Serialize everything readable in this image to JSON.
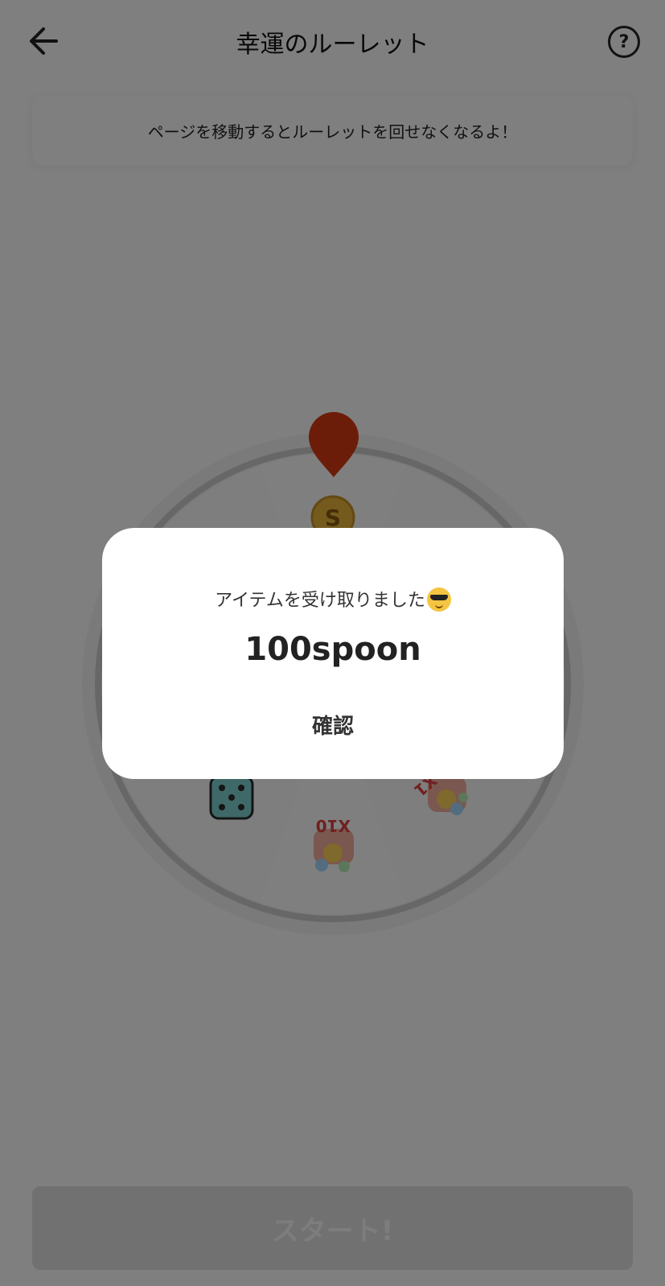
{
  "header": {
    "title": "幸運のルーレット",
    "help_label": "?"
  },
  "notice": {
    "text": "ページを移動するとルーレットを回せなくなるよ！"
  },
  "wheel": {
    "pointer_color": "#d93a12",
    "coin_label": "S",
    "segment_labels": [
      "X10",
      "X1"
    ]
  },
  "start_button": {
    "label": "スタート!"
  },
  "modal": {
    "message": "アイテムを受け取りました",
    "amount": "100spoon",
    "confirm_label": "確認"
  }
}
